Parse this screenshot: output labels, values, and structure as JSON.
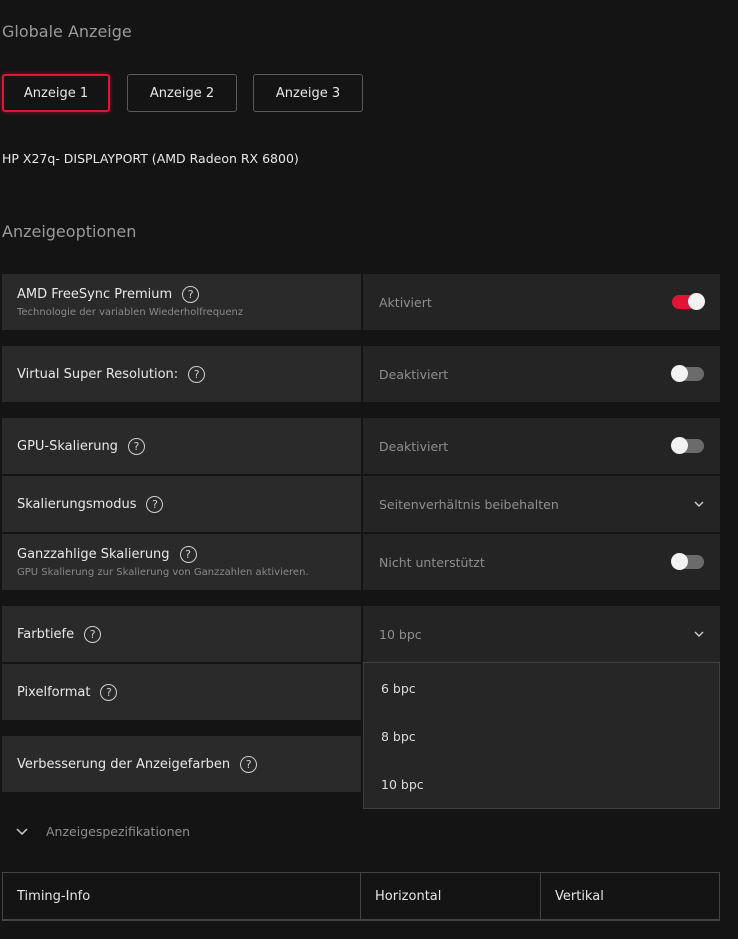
{
  "section_global": "Globale Anzeige",
  "display_tabs": [
    "Anzeige 1",
    "Anzeige 2",
    "Anzeige 3"
  ],
  "active_display": "Anzeige 1",
  "monitor_name": "HP X27q- DISPLAYPORT (AMD Radeon RX 6800)",
  "section_options": "Anzeigeoptionen",
  "options": {
    "freesync": {
      "label": "AMD FreeSync Premium",
      "sub": "Technologie der variablen Wiederholfrequenz",
      "value": "Aktiviert",
      "enabled": true
    },
    "vsr": {
      "label": "Virtual Super Resolution:",
      "value": "Deaktiviert",
      "enabled": false
    },
    "gpu_scaling": {
      "label": "GPU-Skalierung",
      "value": "Deaktiviert",
      "enabled": false
    },
    "scaling_mode": {
      "label": "Skalierungsmodus",
      "value": "Seitenverhältnis beibehalten"
    },
    "integer_scaling": {
      "label": "Ganzzahlige Skalierung",
      "sub": "GPU Skalierung zur Skalierung von Ganzzahlen aktivieren.",
      "value": "Nicht unterstützt",
      "enabled": false
    },
    "color_depth": {
      "label": "Farbtiefe",
      "value": "10 bpc",
      "options": [
        "6 bpc",
        "8 bpc",
        "10 bpc"
      ]
    },
    "pixel_format": {
      "label": "Pixelformat"
    },
    "color_enhance": {
      "label": "Verbesserung der Anzeigefarben"
    }
  },
  "specs_label": "Anzeigespezifikationen",
  "timing_table": {
    "headers": [
      "Timing-Info",
      "Horizontal",
      "Vertikal"
    ]
  },
  "help_glyph": "?",
  "colors": {
    "accent": "#e01434",
    "background": "#141414",
    "panel": "#2a2a2a"
  }
}
